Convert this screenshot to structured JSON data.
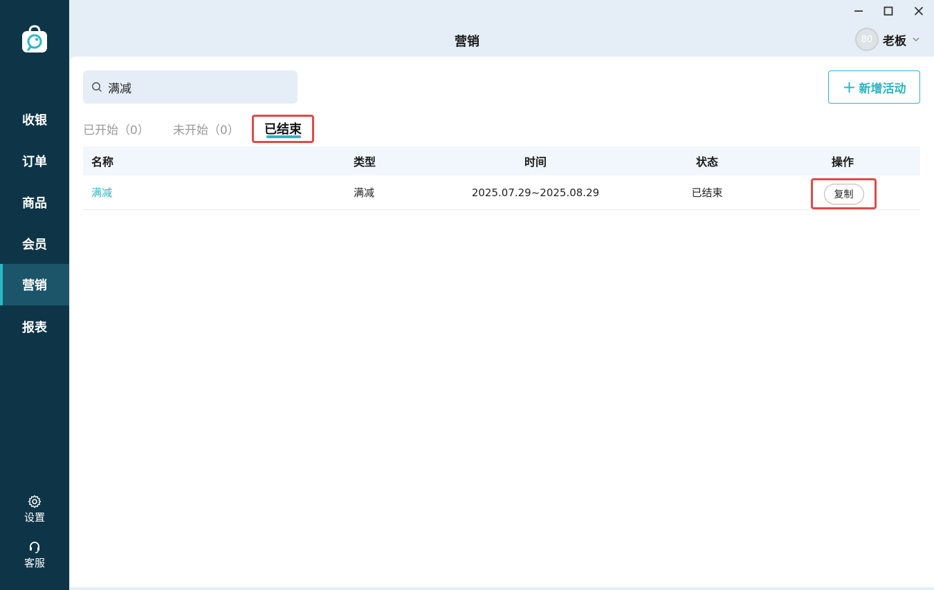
{
  "sidebar": {
    "logo_icon": "shopping-bag-logo-icon",
    "items": [
      {
        "label": "收银"
      },
      {
        "label": "订单"
      },
      {
        "label": "商品"
      },
      {
        "label": "会员"
      },
      {
        "label": "营销",
        "active": true
      },
      {
        "label": "报表"
      }
    ],
    "settings_label": "设置",
    "service_label": "客服"
  },
  "header": {
    "title": "营销",
    "avatar_text": "80",
    "user_name": "老板"
  },
  "toolbar": {
    "search_value": "满减",
    "add_button_label": "新增活动"
  },
  "tabs": {
    "started": "已开始（0）",
    "not_started": "未开始（0）",
    "ended": "已结束"
  },
  "table": {
    "headers": {
      "name": "名称",
      "type": "类型",
      "time": "时间",
      "status": "状态",
      "op": "操作"
    },
    "rows": [
      {
        "name": "满减",
        "type": "满减",
        "time": "2025.07.29~2025.08.29",
        "status": "已结束",
        "op_label": "复制"
      }
    ]
  },
  "colors": {
    "sidebar_bg": "#0e3547",
    "accent": "#2cb5c3",
    "highlight_box": "#e04848",
    "page_bg": "#e5eef6"
  }
}
